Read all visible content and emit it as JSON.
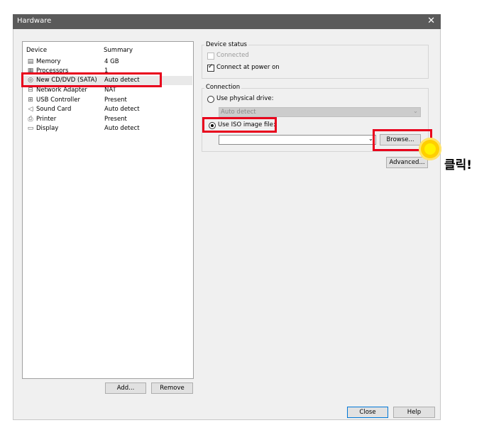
{
  "window": {
    "title": "Hardware",
    "close_glyph": "✕"
  },
  "device_list": {
    "headers": {
      "device": "Device",
      "summary": "Summary"
    },
    "rows": [
      {
        "icon": "memory-icon",
        "glyph": "▤",
        "device": "Memory",
        "summary": "4 GB"
      },
      {
        "icon": "processor-icon",
        "glyph": "▦",
        "device": "Processors",
        "summary": "1"
      },
      {
        "icon": "cd-dvd-icon",
        "glyph": "◎",
        "device": "New CD/DVD (SATA)",
        "summary": "Auto detect"
      },
      {
        "icon": "network-adapter-icon",
        "glyph": "⊟",
        "device": "Network Adapter",
        "summary": "NAT"
      },
      {
        "icon": "usb-icon",
        "glyph": "⊞",
        "device": "USB Controller",
        "summary": "Present"
      },
      {
        "icon": "sound-card-icon",
        "glyph": "◁",
        "device": "Sound Card",
        "summary": "Auto detect"
      },
      {
        "icon": "printer-icon",
        "glyph": "⎙",
        "device": "Printer",
        "summary": "Present"
      },
      {
        "icon": "display-icon",
        "glyph": "▭",
        "device": "Display",
        "summary": "Auto detect"
      }
    ],
    "selected_index": 2
  },
  "buttons": {
    "add": "Add...",
    "remove": "Remove",
    "close": "Close",
    "help": "Help",
    "browse": "Browse...",
    "advanced": "Advanced..."
  },
  "device_status": {
    "group_label": "Device status",
    "connected": {
      "label": "Connected",
      "checked": false,
      "disabled": true
    },
    "connect_at_power_on": {
      "label": "Connect at power on",
      "checked": true
    }
  },
  "connection": {
    "group_label": "Connection",
    "physical_drive": {
      "label": "Use physical drive:",
      "selected": false,
      "value": "Auto detect"
    },
    "iso_image": {
      "label": "Use ISO image file:",
      "selected": true,
      "value": ""
    }
  },
  "annotation": {
    "click_text": "클릭!",
    "highlight_color": "#e8001c",
    "cursor_color": "#ffcf00"
  }
}
